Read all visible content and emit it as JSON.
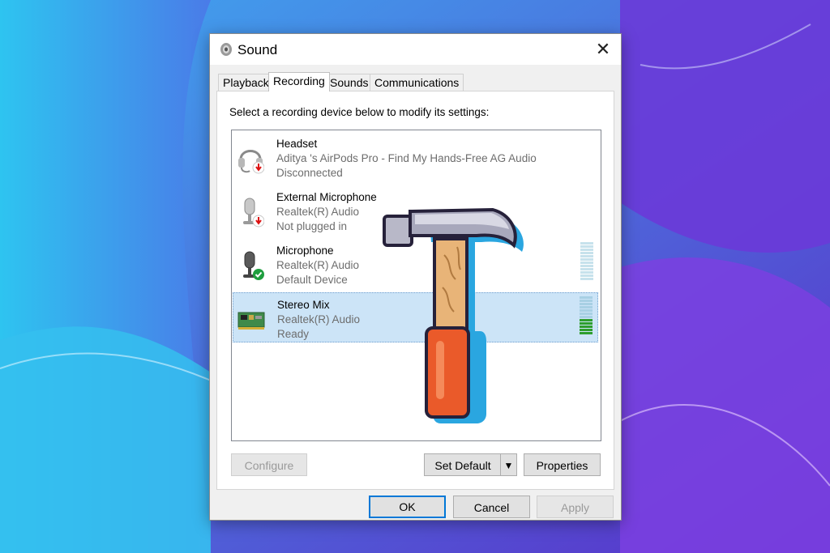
{
  "window": {
    "title": "Sound",
    "close_glyph": "✕"
  },
  "tabs": [
    {
      "label": "Playback"
    },
    {
      "label": "Recording"
    },
    {
      "label": "Sounds"
    },
    {
      "label": "Communications"
    }
  ],
  "active_tab": "Recording",
  "instructions": "Select a recording device below to modify its settings:",
  "devices": [
    {
      "name": "Headset",
      "line2": "Aditya 's AirPods Pro - Find My Hands-Free AG Audio",
      "line3": "Disconnected",
      "icon": "headset-icon",
      "status_icon": "disconnected-arrow-icon"
    },
    {
      "name": "External Microphone",
      "line2": "Realtek(R) Audio",
      "line3": "Not plugged in",
      "icon": "microphone-icon",
      "status_icon": "disconnected-arrow-icon"
    },
    {
      "name": "Microphone",
      "line2": "Realtek(R) Audio",
      "line3": "Default Device",
      "icon": "microphone-icon",
      "status_icon": "default-check-icon"
    },
    {
      "name": "Stereo Mix",
      "line2": "Realtek(R) Audio",
      "line3": "Ready",
      "icon": "sound-card-icon",
      "selected": true
    }
  ],
  "buttons": {
    "configure": "Configure",
    "set_default": "Set Default",
    "properties": "Properties",
    "ok": "OK",
    "cancel": "Cancel",
    "apply": "Apply"
  },
  "colors": {
    "accent": "#0078d7",
    "selection": "#cce4f7",
    "meter_active": "#2e9e2e"
  }
}
